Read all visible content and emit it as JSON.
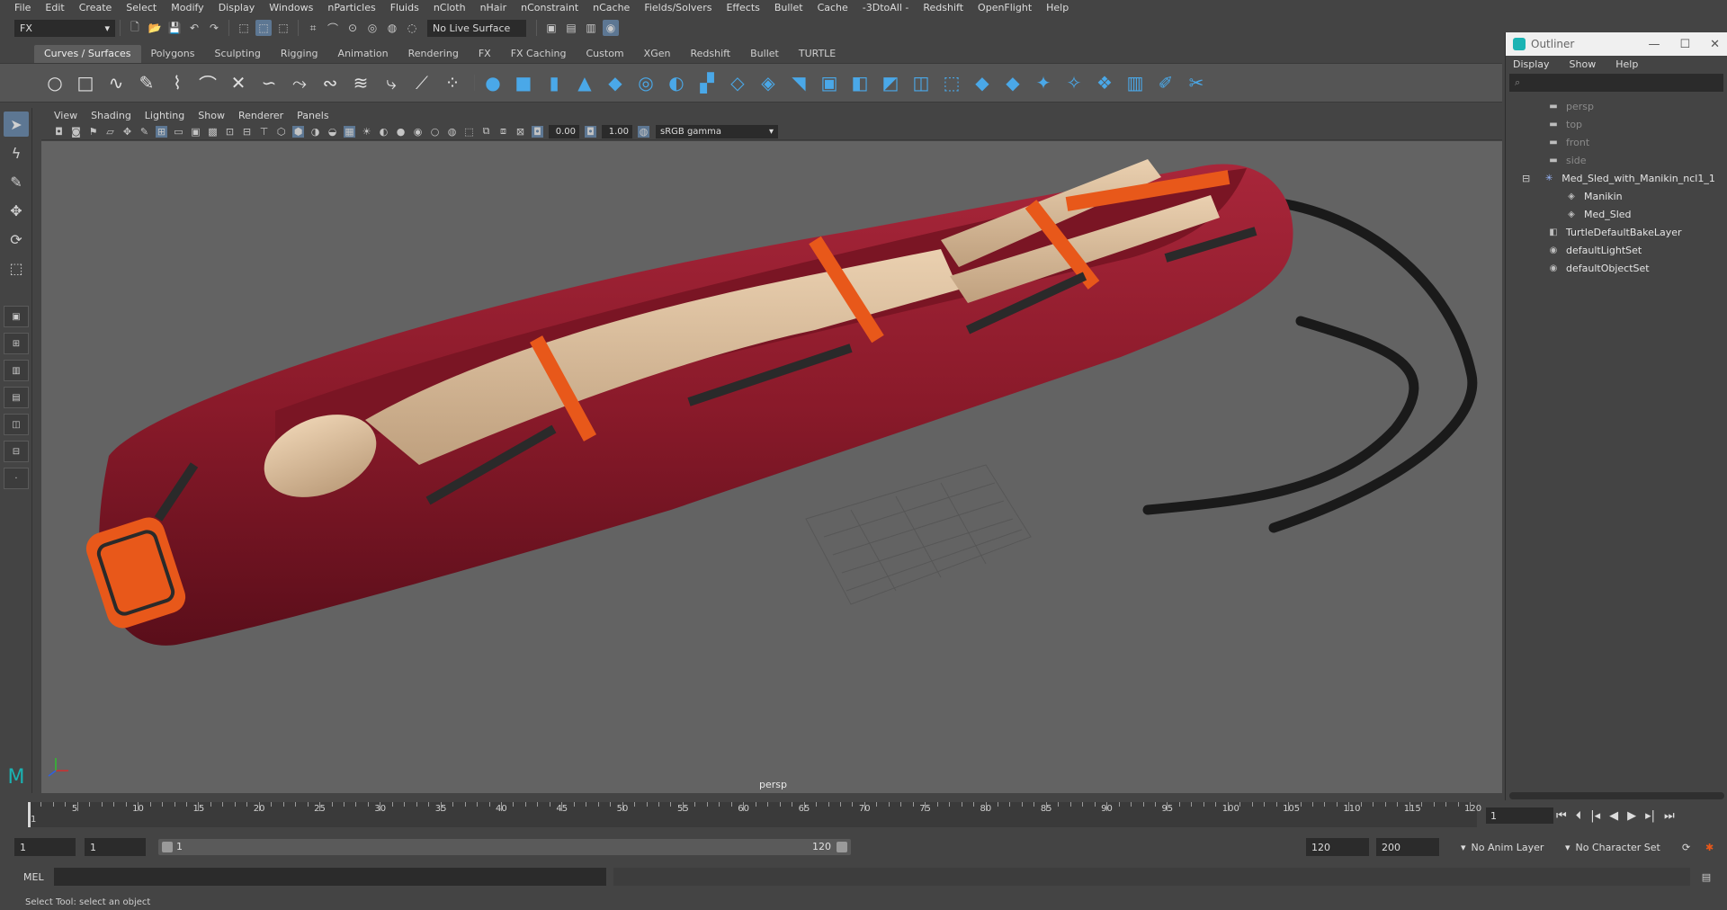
{
  "menubar": [
    "File",
    "Edit",
    "Create",
    "Select",
    "Modify",
    "Display",
    "Windows",
    "nParticles",
    "Fluids",
    "nCloth",
    "nHair",
    "nConstraint",
    "nCache",
    "Fields/Solvers",
    "Effects",
    "Bullet",
    "Cache",
    "-3DtoAll -",
    "Redshift",
    "OpenFlight",
    "Help"
  ],
  "status": {
    "menu_set": "FX",
    "live_surface": "No Live Surface"
  },
  "shelf_tabs": [
    "Curves / Surfaces",
    "Polygons",
    "Sculpting",
    "Rigging",
    "Animation",
    "Rendering",
    "FX",
    "FX Caching",
    "Custom",
    "XGen",
    "Redshift",
    "Bullet",
    "TURTLE"
  ],
  "panel": {
    "menus": [
      "View",
      "Shading",
      "Lighting",
      "Show",
      "Renderer",
      "Panels"
    ],
    "exposure": "0.00",
    "gamma_value": "1.00",
    "color_space": "sRGB gamma",
    "camera_label": "persp"
  },
  "outliner": {
    "title": "Outliner",
    "menus": [
      "Display",
      "Show",
      "Help"
    ],
    "items": [
      {
        "label": "persp",
        "icon": "camera-icon",
        "indent": 0,
        "dim": true
      },
      {
        "label": "top",
        "icon": "camera-icon",
        "indent": 0,
        "dim": true
      },
      {
        "label": "front",
        "icon": "camera-icon",
        "indent": 0,
        "dim": true
      },
      {
        "label": "side",
        "icon": "camera-icon",
        "indent": 0,
        "dim": true
      },
      {
        "label": "Med_Sled_with_Manikin_ncl1_1",
        "icon": "group-icon",
        "indent": 0,
        "dim": false
      },
      {
        "label": "Manikin",
        "icon": "mesh-icon",
        "indent": 1,
        "dim": false
      },
      {
        "label": "Med_Sled",
        "icon": "mesh-icon",
        "indent": 1,
        "dim": false
      },
      {
        "label": "TurtleDefaultBakeLayer",
        "icon": "layer-icon",
        "indent": 0,
        "dim": false
      },
      {
        "label": "defaultLightSet",
        "icon": "set-icon",
        "indent": 0,
        "dim": false
      },
      {
        "label": "defaultObjectSet",
        "icon": "set-icon",
        "indent": 0,
        "dim": false
      }
    ]
  },
  "timeline": {
    "labels": [
      "1",
      "5",
      "10",
      "15",
      "20",
      "25",
      "30",
      "35",
      "40",
      "45",
      "50",
      "55",
      "60",
      "65",
      "70",
      "75",
      "80",
      "85",
      "90",
      "95",
      "100",
      "105",
      "110",
      "115",
      "120"
    ],
    "current_frame": "1"
  },
  "range": {
    "start": "1",
    "playback_start": "1",
    "range_left": "1",
    "range_right": "120",
    "playback_end": "120",
    "end": "200",
    "anim_layer": "No Anim Layer",
    "character_set": "No Character Set"
  },
  "command": {
    "label": "MEL"
  },
  "help_line": "Select Tool: select an object",
  "colors": {
    "sled": "#8a1a2a",
    "strap": "#e8581a",
    "manikin": "#d7b897",
    "viewport": "#636363"
  }
}
